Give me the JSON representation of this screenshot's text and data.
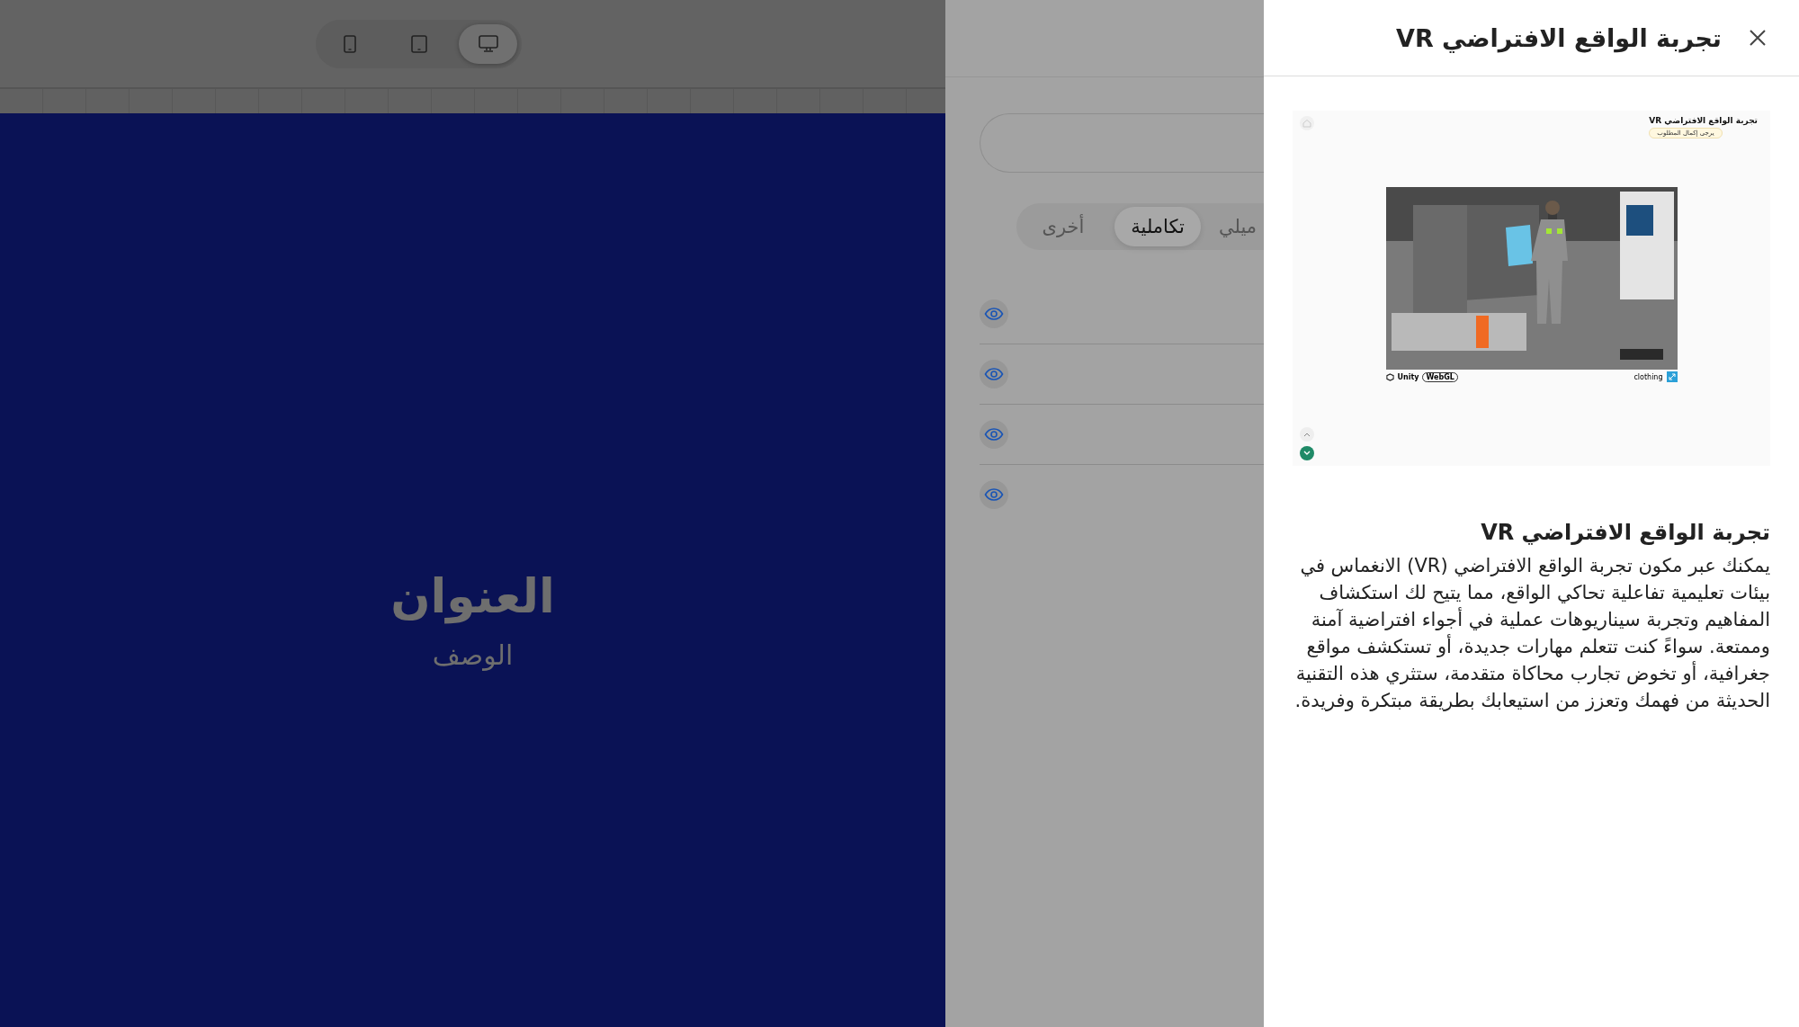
{
  "toolbar": {
    "devices": [
      {
        "kind": "phone",
        "selected": false
      },
      {
        "kind": "tablet",
        "selected": false
      },
      {
        "kind": "desktop",
        "selected": true
      }
    ]
  },
  "canvas": {
    "title": "العنوان",
    "description": "الوصف"
  },
  "side_panel": {
    "tabs": [
      {
        "label": "ميلي",
        "selected": false
      },
      {
        "label": "تكاملية",
        "selected": true
      },
      {
        "label": "أخرى",
        "selected": false
      }
    ],
    "items": [
      {
        "kind": "eye"
      },
      {
        "kind": "eye"
      },
      {
        "kind": "eye"
      },
      {
        "kind": "eye"
      }
    ]
  },
  "drawer": {
    "title": "تجربة الواقع الافتراضي VR",
    "preview": {
      "page_title": "تجربة الواقع الافتراضي VR",
      "badge": "يرجى إكمال المطلوب",
      "engine_label": "Unity",
      "platform_label": "WebGL",
      "app_label": "clothing"
    },
    "heading": "تجربة الواقع الافتراضي VR",
    "description": "يمكنك عبر مكون تجربة الواقع الافتراضي (VR) الانغماس في بيئات تعليمية تفاعلية تحاكي الواقع، مما يتيح لك استكشاف المفاهيم وتجربة سيناريوهات عملية في أجواء افتراضية آمنة وممتعة. سواءً كنت تتعلم مهارات جديدة، أو تستكشف مواقع جغرافية، أو تخوض تجارب محاكاة متقدمة، ستثري هذه التقنية الحديثة من فهمك وتعزز من استيعابك بطريقة مبتكرة وفريدة."
  }
}
